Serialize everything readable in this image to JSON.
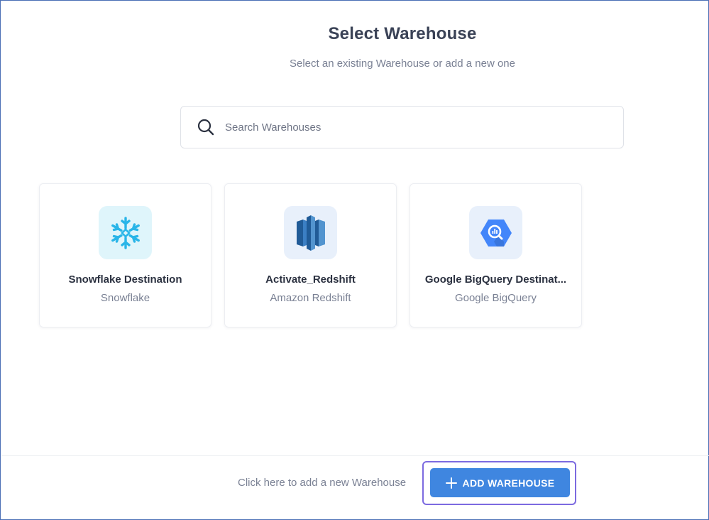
{
  "header": {
    "title": "Select Warehouse",
    "subtitle": "Select an existing Warehouse or add a new one"
  },
  "search": {
    "placeholder": "Search Warehouses",
    "value": "",
    "icon": "search-icon"
  },
  "warehouses": [
    {
      "name": "Snowflake Destination",
      "type": "Snowflake",
      "icon": "snowflake-icon",
      "color": "#29b5e8"
    },
    {
      "name": "Activate_Redshift",
      "type": "Amazon Redshift",
      "icon": "redshift-icon",
      "color": "#2e73b8"
    },
    {
      "name": "Google BigQuery Destinat...",
      "type": "Google BigQuery",
      "icon": "bigquery-icon",
      "color": "#4386fa"
    }
  ],
  "footer": {
    "hint": "Click here to add a new Warehouse",
    "add_button_label": "ADD WAREHOUSE",
    "add_button_icon": "plus-icon"
  },
  "colors": {
    "accent": "#3f86e0",
    "focus_outline": "#7c6ae0"
  }
}
